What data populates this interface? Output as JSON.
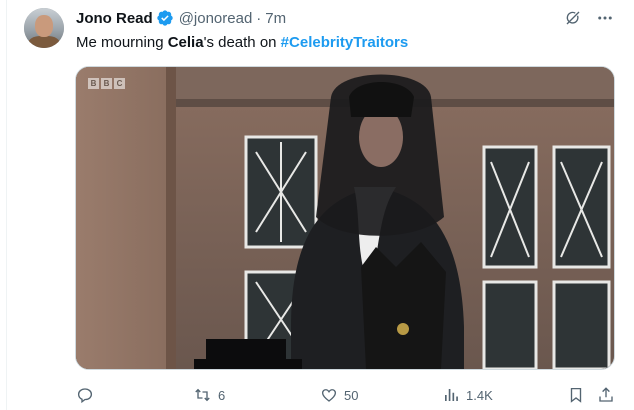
{
  "tweet": {
    "author_name": "Jono Read",
    "handle": "@jonoread",
    "separator": "·",
    "time": "7m",
    "text_prefix": "Me mourning ",
    "text_bold": "Celia",
    "text_middle": "'s death on ",
    "hashtag": "#CelebrityTraitors",
    "media_watermark": [
      "B",
      "B",
      "C"
    ]
  },
  "actions": {
    "replies": "",
    "reposts": "6",
    "likes": "50",
    "views": "1.4K"
  },
  "colors": {
    "accent": "#1d9bf0",
    "secondary_text": "#536471",
    "primary_text": "#0f1419"
  },
  "icons": [
    "grok-icon",
    "more-icon",
    "reply-icon",
    "repost-icon",
    "like-icon",
    "views-icon",
    "bookmark-icon",
    "share-icon",
    "verified-icon"
  ]
}
